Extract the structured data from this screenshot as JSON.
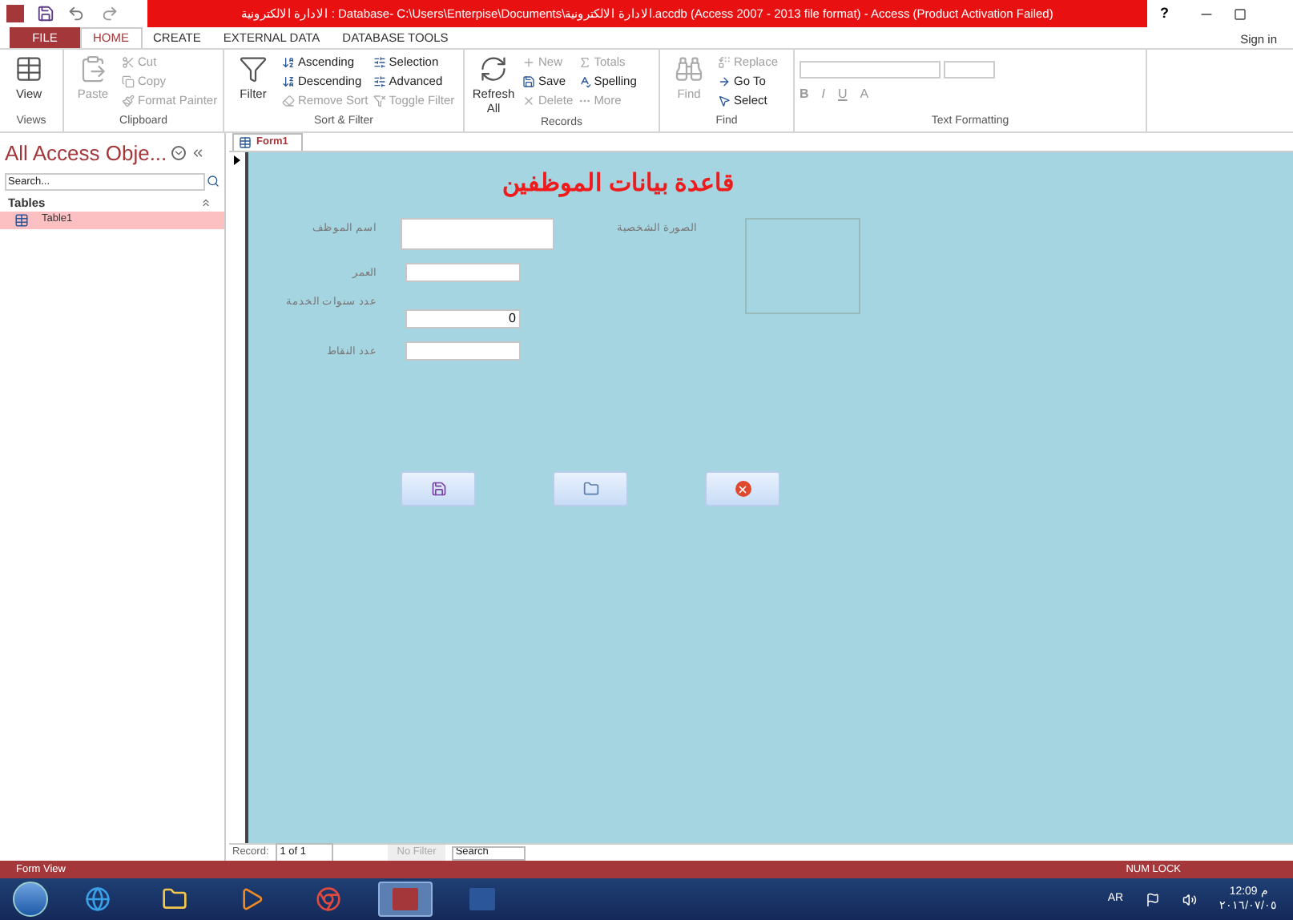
{
  "title_bar": {
    "title": "الادارة الالكترونية : Database- C:\\Users\\Enterpise\\Documents\\الادارة الالكترونية.accdb (Access 2007 - 2013 file format) -  Access (Product Activation Failed)",
    "help": "?",
    "sign_in": "Sign in"
  },
  "ribbon_tabs": [
    {
      "label": "FILE",
      "selected": false,
      "kind": "file"
    },
    {
      "label": "HOME",
      "selected": true,
      "kind": "tab"
    },
    {
      "label": "CREATE",
      "selected": false,
      "kind": "tab"
    },
    {
      "label": "EXTERNAL DATA",
      "selected": false,
      "kind": "tab"
    },
    {
      "label": "DATABASE TOOLS",
      "selected": false,
      "kind": "tab"
    }
  ],
  "ribbon_groups": [
    {
      "name": "Views",
      "items": [
        {
          "label": "View",
          "kind": "large",
          "disabled": false
        }
      ]
    },
    {
      "name": "Clipboard",
      "items": [
        {
          "label": "Paste",
          "kind": "large",
          "disabled": true
        },
        {
          "label": "Cut",
          "kind": "small",
          "disabled": true
        },
        {
          "label": "Copy",
          "kind": "small",
          "disabled": true
        },
        {
          "label": "Format Painter",
          "kind": "small",
          "disabled": true
        }
      ]
    },
    {
      "name": "Sort & Filter",
      "items": [
        {
          "label": "Filter",
          "kind": "large",
          "disabled": false
        },
        {
          "label": "Ascending",
          "kind": "small",
          "disabled": false
        },
        {
          "label": "Descending",
          "kind": "small",
          "disabled": false
        },
        {
          "label": "Remove Sort",
          "kind": "small",
          "disabled": true
        },
        {
          "label": "Selection",
          "kind": "small",
          "disabled": false
        },
        {
          "label": "Advanced",
          "kind": "small",
          "disabled": false
        },
        {
          "label": "Toggle Filter",
          "kind": "small",
          "disabled": true
        }
      ]
    },
    {
      "name": "Records",
      "items": [
        {
          "label": "Refresh All",
          "kind": "large",
          "disabled": false
        },
        {
          "label": "New",
          "kind": "small",
          "disabled": true
        },
        {
          "label": "Save",
          "kind": "small",
          "disabled": false
        },
        {
          "label": "Delete",
          "kind": "small",
          "disabled": true
        },
        {
          "label": "Totals",
          "kind": "small",
          "disabled": true
        },
        {
          "label": "Spelling",
          "kind": "small",
          "disabled": false
        },
        {
          "label": "More",
          "kind": "small",
          "disabled": true
        }
      ]
    },
    {
      "name": "Find",
      "items": [
        {
          "label": "Find",
          "kind": "large",
          "disabled": true
        },
        {
          "label": "Replace",
          "kind": "small",
          "disabled": true
        },
        {
          "label": "Go To",
          "kind": "small",
          "disabled": false
        },
        {
          "label": "Select",
          "kind": "small",
          "disabled": false
        }
      ]
    },
    {
      "name": "Text Formatting",
      "items": [
        {
          "label": "B",
          "kind": "format",
          "disabled": true
        },
        {
          "label": "I",
          "kind": "format",
          "disabled": true
        },
        {
          "label": "U",
          "kind": "format",
          "disabled": true
        },
        {
          "label": "A",
          "kind": "format",
          "disabled": true
        }
      ]
    }
  ],
  "nav_pane": {
    "title": "All Access Obje...",
    "search": {
      "placeholder": "Search..."
    },
    "group": "Tables",
    "items": [
      {
        "label": "Table1",
        "selected": true
      }
    ]
  },
  "document_tab": {
    "label": "Form1"
  },
  "form": {
    "title": "قاعدة بيانات الموظفين",
    "fields": [
      {
        "label": "اسم الموظف",
        "kind": "large"
      },
      {
        "label": "العمر",
        "kind": "normal"
      },
      {
        "label": "عدد سنوات الخدمة",
        "kind": "normal",
        "value": "0"
      },
      {
        "label": "عدد النقاط",
        "kind": "normal"
      }
    ],
    "picture_label": "الصورة الشخصية",
    "buttons": [
      {
        "kind": "save"
      },
      {
        "kind": "new"
      },
      {
        "kind": "close"
      }
    ]
  },
  "record_nav": {
    "label": "Record:",
    "position": "1 of 1",
    "filter": "No Filter",
    "search": {
      "placeholder": "Search"
    }
  },
  "status_bar": {
    "view": "Form View",
    "indicator": "NUM LOCK"
  },
  "taskbar": {
    "apps": [
      {
        "kind": "ie",
        "selected": false
      },
      {
        "kind": "folder",
        "selected": false
      },
      {
        "kind": "media",
        "selected": false
      },
      {
        "kind": "chrome",
        "selected": false
      },
      {
        "kind": "access",
        "selected": true
      },
      {
        "kind": "word",
        "selected": false
      }
    ],
    "language": "AR",
    "time": "12:09 م",
    "date": "٢٠١٦/٠٧/٠٥"
  }
}
